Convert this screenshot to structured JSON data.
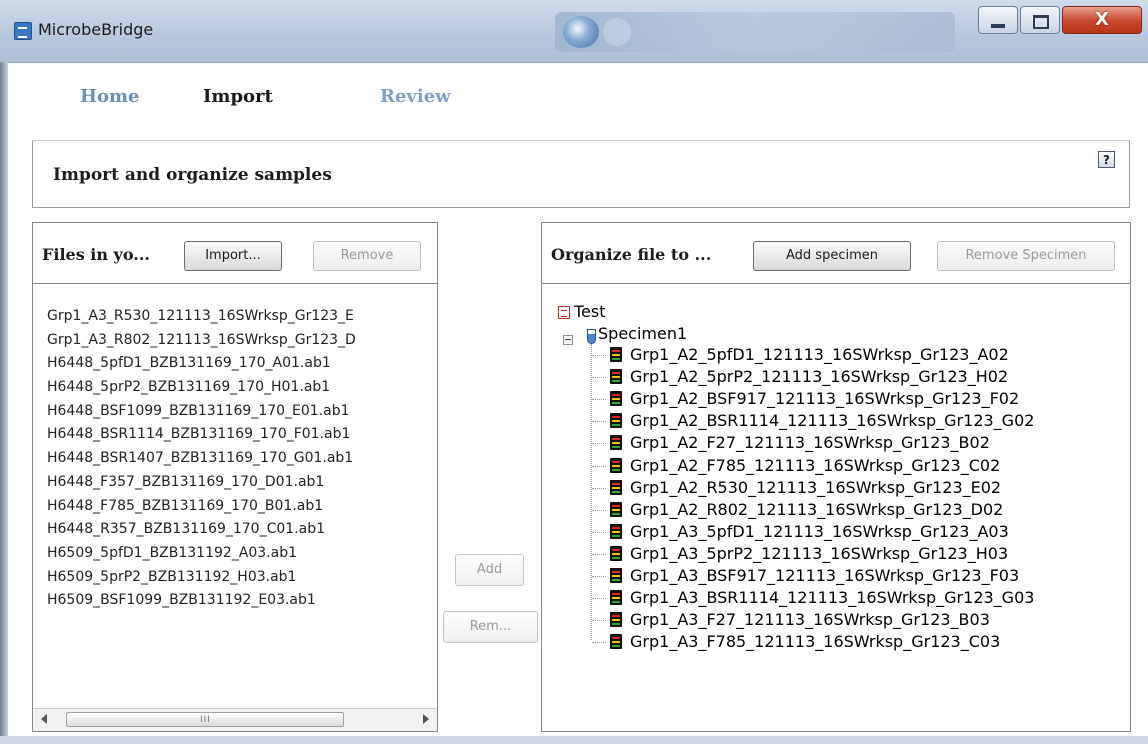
{
  "window": {
    "title": "MicrobeBridge"
  },
  "nav": {
    "home": "Home",
    "import": "Import",
    "review": "Review"
  },
  "header": {
    "title": "Import and organize samples",
    "help": "?"
  },
  "left_panel": {
    "title": "Files in yo...",
    "import_button": "Import...",
    "remove_button": "Remove",
    "files": [
      "Grp1_A3_R530_121113_16SWrksp_Gr123_E",
      "Grp1_A3_R802_121113_16SWrksp_Gr123_D",
      "H6448_5pfD1_BZB131169_170_A01.ab1",
      "H6448_5prP2_BZB131169_170_H01.ab1",
      "H6448_BSF1099_BZB131169_170_E01.ab1",
      "H6448_BSR1114_BZB131169_170_F01.ab1",
      "H6448_BSR1407_BZB131169_170_G01.ab1",
      "H6448_F357_BZB131169_170_D01.ab1",
      "H6448_F785_BZB131169_170_B01.ab1",
      "H6448_R357_BZB131169_170_C01.ab1",
      "H6509_5pfD1_BZB131192_A03.ab1",
      "H6509_5prP2_BZB131192_H03.ab1",
      "H6509_BSF1099_BZB131192_E03.ab1"
    ],
    "scroll_grip": "III"
  },
  "middle": {
    "add_button": "Add",
    "remove_button": "Rem..."
  },
  "right_panel": {
    "title": "Organize file to ...",
    "add_specimen_button": "Add specimen",
    "remove_specimen_button": "Remove Specimen",
    "tree": {
      "root": "Test",
      "specimen": "Specimen1",
      "files": [
        "Grp1_A2_5pfD1_121113_16SWrksp_Gr123_A02",
        "Grp1_A2_5prP2_121113_16SWrksp_Gr123_H02",
        "Grp1_A2_BSF917_121113_16SWrksp_Gr123_F02",
        "Grp1_A2_BSR1114_121113_16SWrksp_Gr123_G02",
        "Grp1_A2_F27_121113_16SWrksp_Gr123_B02",
        "Grp1_A2_F785_121113_16SWrksp_Gr123_C02",
        "Grp1_A2_R530_121113_16SWrksp_Gr123_E02",
        "Grp1_A2_R802_121113_16SWrksp_Gr123_D02",
        "Grp1_A3_5pfD1_121113_16SWrksp_Gr123_A03",
        "Grp1_A3_5prP2_121113_16SWrksp_Gr123_H03",
        "Grp1_A3_BSF917_121113_16SWrksp_Gr123_F03",
        "Grp1_A3_BSR1114_121113_16SWrksp_Gr123_G03",
        "Grp1_A3_F27_121113_16SWrksp_Gr123_B03",
        "Grp1_A3_F785_121113_16SWrksp_Gr123_C03"
      ]
    }
  },
  "icons": {
    "app": "app-icon",
    "help": "help-icon",
    "root": "document-icon",
    "specimen": "test-tube-icon",
    "file": "chromatogram-file-icon"
  },
  "colors": {
    "nav_active": "#1a1a1a",
    "nav_inactive": "#6a90b8",
    "close_button": "#c8472e"
  }
}
